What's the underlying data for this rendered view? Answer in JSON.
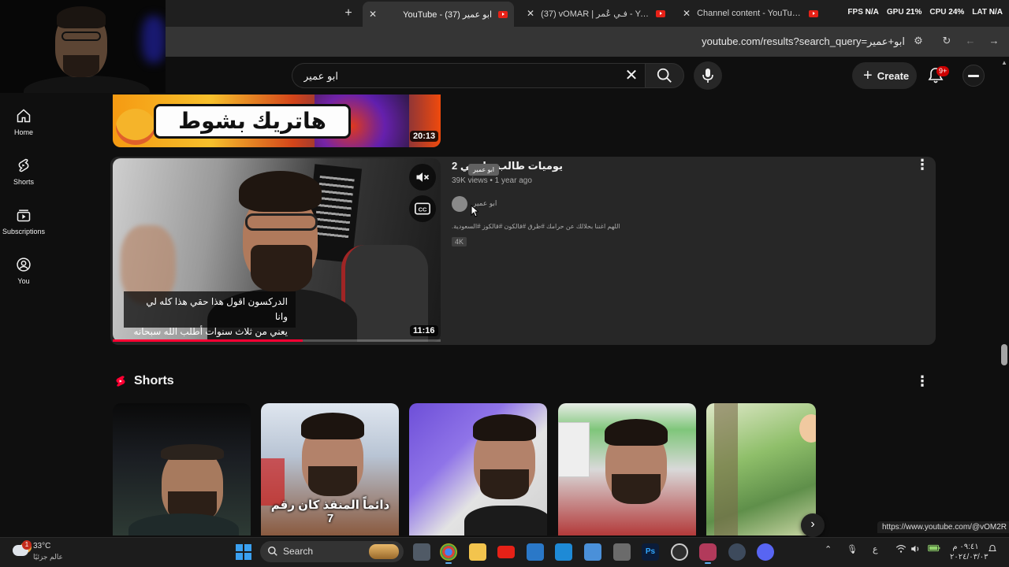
{
  "browser": {
    "tabs": [
      {
        "label": "YouTube - ابو عمير (37)",
        "active": true
      },
      {
        "label": "(37) vOMAR | فـي عُمر - YouTube",
        "active": false
      },
      {
        "label": "Channel content - YouTube Stu",
        "active": false
      }
    ],
    "new_tab": "+",
    "url": "youtube.com/results?search_query=ابو+عمير",
    "overlay": {
      "fps_label": "FPS",
      "fps_value": "N/A",
      "gpu_label": "GPU",
      "gpu_value": "21%",
      "cpu_label": "CPU",
      "cpu_value": "24%",
      "lat_label": "LAT",
      "lat_value": "N/A"
    }
  },
  "youtube": {
    "search": {
      "value": "ابو عمير",
      "placeholder": "Search"
    },
    "create_label": "Create",
    "notifications_badge": "9+",
    "sidebar": [
      {
        "label": "Home",
        "icon": "home-icon"
      },
      {
        "label": "Shorts",
        "icon": "shorts-icon"
      },
      {
        "label": "Subscriptions",
        "icon": "subscriptions-icon"
      },
      {
        "label": "You",
        "icon": "you-icon"
      }
    ],
    "top_result": {
      "thumb_text": "هاتريك بشوط",
      "duration": "20:13"
    },
    "main_result": {
      "title": "يوميات طالب جامعي 2",
      "views": "39K views",
      "age": "1 year ago",
      "tooltip": "ابو عمير",
      "channel": "ابو عمير",
      "description": "اللهم اغننا بحلالك عن حرامك #ظرق #قالكون #قالكوز #السعودية.",
      "badge": "4K",
      "duration": "11:16",
      "caption_line1": "الدركسون اقول هذا حقي هذا كله لي وانا",
      "caption_line2": "يعني من ثلاث سنوات أطلب الله سبحانه",
      "progress_fraction": 0.58
    },
    "shorts": {
      "title": "Shorts",
      "caption": "دائماً المنقذ كان رقم 7"
    },
    "status_url": "https://www.youtube.com/@vOM2R"
  },
  "taskbar": {
    "weather_temp": "33°C",
    "weather_desc": "عالم جزئيًا",
    "weather_badge": "1",
    "search_label": "Search",
    "tray_lang": "ع",
    "clock_time": "٠٩:٤١ م",
    "clock_date": "٢٠٢٤/٠٣/٠٣"
  },
  "colors": {
    "accent": "#ff0033",
    "badge": "#cc0000",
    "background": "#0f0f0f"
  }
}
